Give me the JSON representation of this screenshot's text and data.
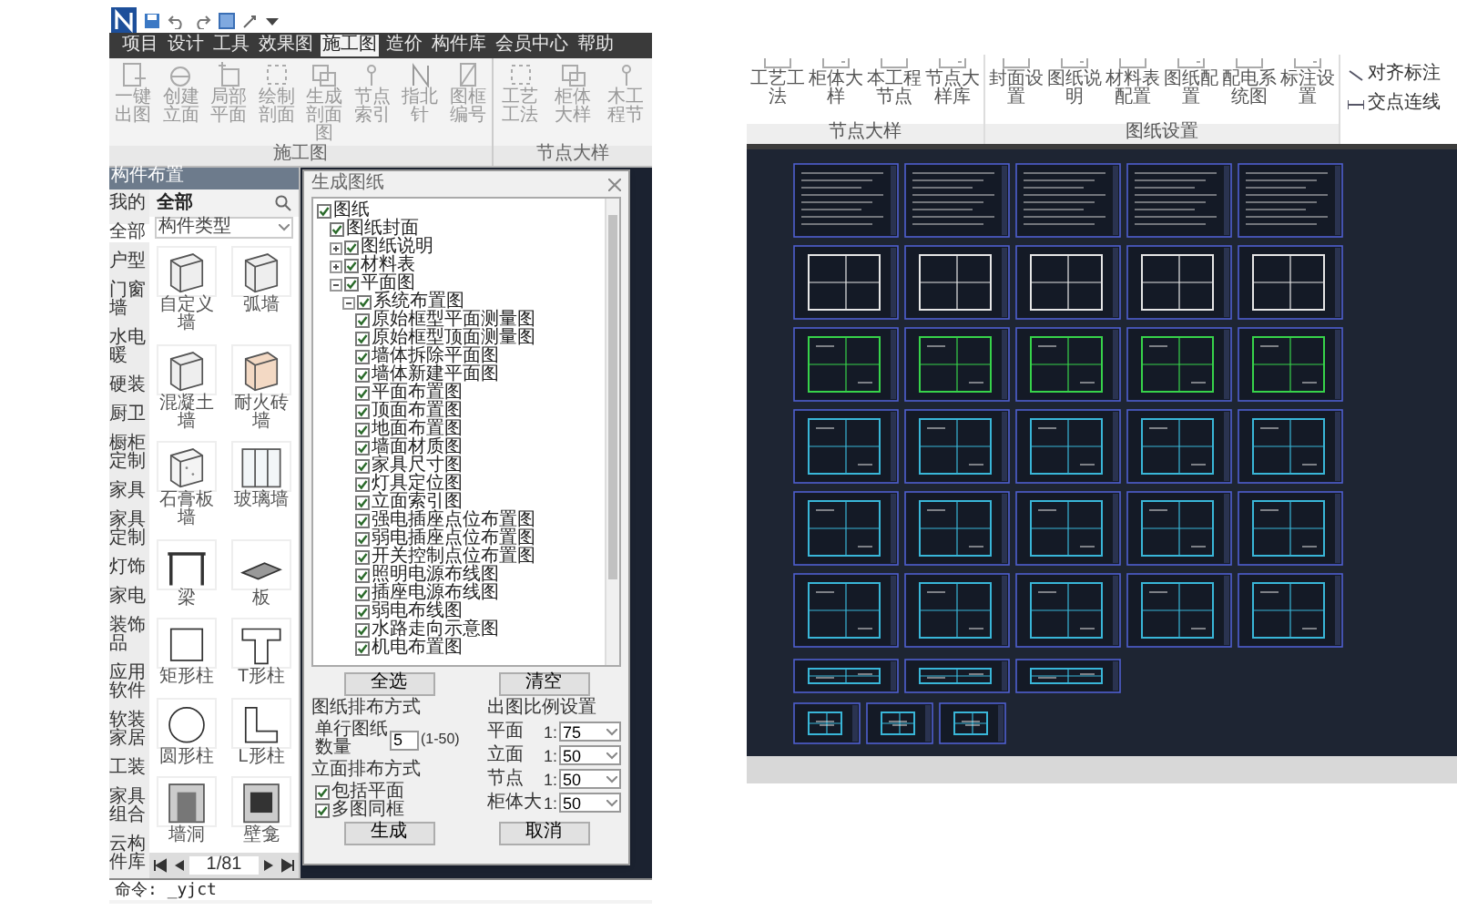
{
  "left_app": {
    "tabs": [
      {
        "label": "项目",
        "selected": false
      },
      {
        "label": "设计",
        "selected": false
      },
      {
        "label": "工具",
        "selected": false
      },
      {
        "label": "效果图",
        "selected": false
      },
      {
        "label": "施工图",
        "selected": true
      },
      {
        "label": "造价",
        "selected": false
      },
      {
        "label": "构件库",
        "selected": false
      },
      {
        "label": "会员中心",
        "selected": false
      },
      {
        "label": "帮助",
        "selected": false
      }
    ],
    "ribbon_groups": [
      {
        "label": "施工图",
        "buttons": [
          "一键出图",
          "创建立面",
          "局部平面",
          "绘制剖面",
          "生成剖面图",
          "节点索引",
          "指北针",
          "图框编号"
        ]
      },
      {
        "label": "节点大样",
        "buttons": [
          "工艺工法",
          "柜体大样",
          "木工程节"
        ]
      }
    ],
    "sidebar": {
      "title": "构件布置",
      "categories": [
        {
          "label": "我的",
          "selected": false
        },
        {
          "label": "全部",
          "selected": true
        },
        {
          "label": "户型",
          "selected": false
        },
        {
          "label": "门窗墙",
          "selected": false
        },
        {
          "label": "水电暖",
          "selected": false
        },
        {
          "label": "硬装",
          "selected": false
        },
        {
          "label": "厨卫",
          "selected": false
        },
        {
          "label": "橱柜定制",
          "selected": false
        },
        {
          "label": "家具",
          "selected": false
        },
        {
          "label": "家具定制",
          "selected": false
        },
        {
          "label": "灯饰",
          "selected": false
        },
        {
          "label": "家电",
          "selected": false
        },
        {
          "label": "装饰品",
          "selected": false
        },
        {
          "label": "应用软件",
          "selected": false
        },
        {
          "label": "软装家居",
          "selected": false
        },
        {
          "label": "工装",
          "selected": false
        },
        {
          "label": "家具组合",
          "selected": false
        },
        {
          "label": "云构件库",
          "selected": false
        }
      ],
      "panel_title": "全部",
      "filter": "构件类型",
      "items": [
        {
          "label": "自定义墙",
          "kind": "wall"
        },
        {
          "label": "弧墙",
          "kind": "wall"
        },
        {
          "label": "混凝土墙",
          "kind": "wall"
        },
        {
          "label": "耐火砖墙",
          "kind": "brick"
        },
        {
          "label": "石膏板墙",
          "kind": "board"
        },
        {
          "label": "玻璃墙",
          "kind": "glass"
        },
        {
          "label": "梁",
          "kind": "beam"
        },
        {
          "label": "板",
          "kind": "slab"
        },
        {
          "label": "矩形柱",
          "kind": "square"
        },
        {
          "label": "T形柱",
          "kind": "tee"
        },
        {
          "label": "圆形柱",
          "kind": "round"
        },
        {
          "label": "L形柱",
          "kind": "ell"
        },
        {
          "label": "墙洞",
          "kind": "opening"
        },
        {
          "label": "壁龛",
          "kind": "niche"
        }
      ],
      "page": "1/81"
    },
    "dialog": {
      "title": "生成图纸",
      "tree": [
        {
          "label": "图纸",
          "checked": true,
          "children": [
            {
              "label": "图纸封面",
              "checked": true
            },
            {
              "label": "图纸说明",
              "checked": true,
              "expanded": false
            },
            {
              "label": "材料表",
              "checked": true,
              "expanded": false
            },
            {
              "label": "平面图",
              "checked": true,
              "expanded": true,
              "children": [
                {
                  "label": "系统布置图",
                  "checked": true,
                  "expanded": true,
                  "children": [
                    {
                      "label": "原始框型平面测量图",
                      "checked": true
                    },
                    {
                      "label": "原始框型顶面测量图",
                      "checked": true
                    },
                    {
                      "label": "墙体拆除平面图",
                      "checked": true
                    },
                    {
                      "label": "墙体新建平面图",
                      "checked": true
                    },
                    {
                      "label": "平面布置图",
                      "checked": true
                    },
                    {
                      "label": "顶面布置图",
                      "checked": true
                    },
                    {
                      "label": "地面布置图",
                      "checked": true
                    },
                    {
                      "label": "墙面材质图",
                      "checked": true
                    },
                    {
                      "label": "家具尺寸图",
                      "checked": true
                    },
                    {
                      "label": "灯具定位图",
                      "checked": true
                    },
                    {
                      "label": "立面索引图",
                      "checked": true
                    },
                    {
                      "label": "强电插座点位布置图",
                      "checked": true
                    },
                    {
                      "label": "弱电插座点位布置图",
                      "checked": true
                    },
                    {
                      "label": "开关控制点位布置图",
                      "checked": true
                    },
                    {
                      "label": "照明电源布线图",
                      "checked": true
                    },
                    {
                      "label": "插座电源布线图",
                      "checked": true
                    },
                    {
                      "label": "弱电布线图",
                      "checked": true
                    },
                    {
                      "label": "水路走向示意图",
                      "checked": true
                    },
                    {
                      "label": "机电布置图",
                      "checked": true
                    }
                  ]
                }
              ]
            }
          ]
        }
      ],
      "tree_buttons": [
        "全选",
        "清空"
      ],
      "layout": {
        "title": "图纸排布方式",
        "field_label": "单行图纸数量",
        "value": "5",
        "range": "(1-50)"
      },
      "elevation": {
        "title": "立面排布方式",
        "options": [
          {
            "label": "包括平面",
            "checked": true
          },
          {
            "label": "多图同框",
            "checked": true
          }
        ]
      },
      "scale": {
        "title": "出图比例设置",
        "rows": [
          {
            "label": "平面",
            "prefix": "1:",
            "value": "75"
          },
          {
            "label": "立面",
            "prefix": "1:",
            "value": "50"
          },
          {
            "label": "节点",
            "prefix": "1:",
            "value": "50"
          },
          {
            "label": "柜体大",
            "prefix": "1:",
            "value": "50"
          }
        ]
      },
      "actions": [
        "生成",
        "取消"
      ]
    },
    "command_line": "命令: _yjct"
  },
  "right_app": {
    "ribbon_groups": [
      {
        "label": "节点大样",
        "buttons": [
          "工艺工法",
          "柜体大样",
          "本工程节点",
          "节点大样库"
        ]
      },
      {
        "label": "图纸设置",
        "buttons": [
          "封面设置",
          "图纸说明",
          "材料表配置",
          "图纸配置",
          "配电系统图",
          "标注设置"
        ]
      }
    ],
    "side_tools": [
      "对齐标注",
      "交点连线"
    ]
  }
}
